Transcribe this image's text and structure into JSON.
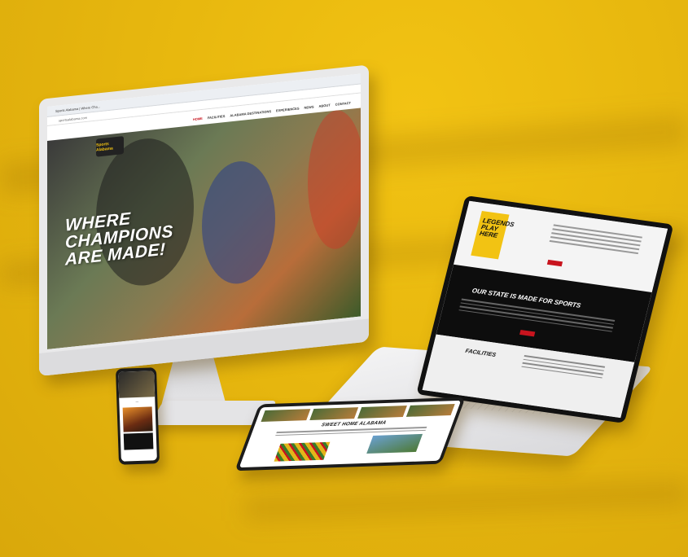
{
  "scene": {
    "background_color": "#e7b70e",
    "accent_red": "#c8141e"
  },
  "desktop": {
    "browser_tab": "Sports Alabama | Where Cha...",
    "url": "sportsalabama.com",
    "nav": [
      "HOME",
      "FACILITIES",
      "ALABAMA DESTINATIONS",
      "EXPERIENCES",
      "NEWS",
      "ABOUT",
      "CONTACT"
    ],
    "logo_text": "Sports Alabama",
    "hero_lines": [
      "WHERE",
      "CHAMPIONS",
      "ARE MADE!"
    ]
  },
  "laptop": {
    "legends_lines": [
      "LEGENDS",
      "PLAY",
      "HERE"
    ],
    "band_title": "OUR STATE IS MADE FOR SPORTS",
    "facilities_title": "FACILITIES"
  },
  "tablet": {
    "heading": "SWEET HOME ALABAMA"
  }
}
